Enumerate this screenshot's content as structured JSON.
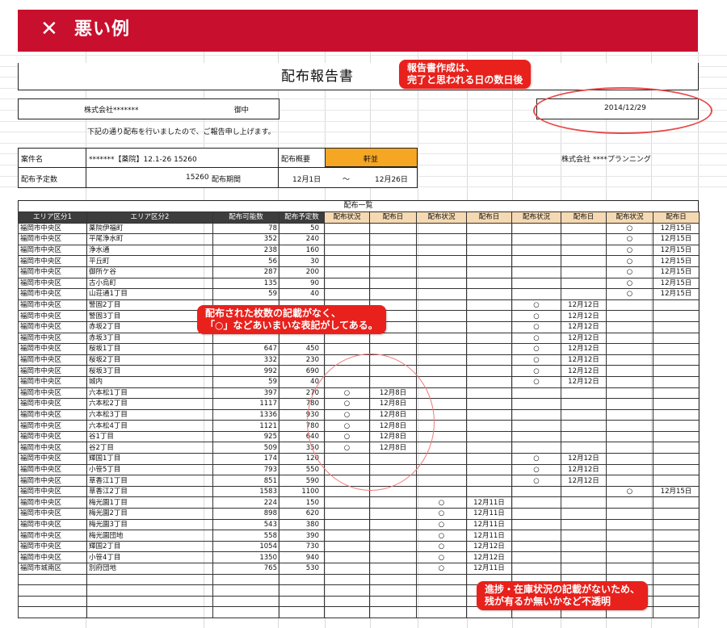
{
  "banner": {
    "mark": "✕",
    "title": "悪い例"
  },
  "report": {
    "title": "配布報告書",
    "recipient_company": "株式会社*******",
    "honorific": "御中",
    "date": "2014/12/29",
    "intro": "下記の通り配布を行いましたので、ご報告申し上げます。",
    "case_label": "案件名",
    "case_value": "*******【薬院】12.1-26 15260",
    "outline_label": "配布概要",
    "outline_value": "軒並",
    "sender": "株式会社 ****プランニング",
    "planned_label": "配布予定数",
    "planned_value": "15260",
    "period_label": "配布期間",
    "period_start": "12月1日",
    "period_sep": "～",
    "period_end": "12月26日"
  },
  "list": {
    "title": "配布一覧",
    "headers": [
      "エリア区分1",
      "エリア区分2",
      "配布可能数",
      "配布予定数",
      "配布状況",
      "配布日",
      "配布状況",
      "配布日",
      "配布状況",
      "配布日",
      "配布状況",
      "配布日"
    ],
    "rows": [
      [
        "福岡市中央区",
        "薬院伊福町",
        "78",
        "50",
        "",
        "",
        "",
        "",
        "",
        "",
        "○",
        "12月15日"
      ],
      [
        "福岡市中央区",
        "平尾浄水町",
        "352",
        "240",
        "",
        "",
        "",
        "",
        "",
        "",
        "○",
        "12月15日"
      ],
      [
        "福岡市中央区",
        "浄水通",
        "238",
        "160",
        "",
        "",
        "",
        "",
        "",
        "",
        "○",
        "12月15日"
      ],
      [
        "福岡市中央区",
        "平丘町",
        "56",
        "30",
        "",
        "",
        "",
        "",
        "",
        "",
        "○",
        "12月15日"
      ],
      [
        "福岡市中央区",
        "御所ケ谷",
        "287",
        "200",
        "",
        "",
        "",
        "",
        "",
        "",
        "○",
        "12月15日"
      ],
      [
        "福岡市中央区",
        "古小烏町",
        "135",
        "90",
        "",
        "",
        "",
        "",
        "",
        "",
        "○",
        "12月15日"
      ],
      [
        "福岡市中央区",
        "山荘通1丁目",
        "59",
        "40",
        "",
        "",
        "",
        "",
        "",
        "",
        "○",
        "12月15日"
      ],
      [
        "福岡市中央区",
        "警固2丁目",
        "",
        "",
        "",
        "",
        "",
        "",
        "○",
        "12月12日",
        "",
        ""
      ],
      [
        "福岡市中央区",
        "警固3丁目",
        "",
        "",
        "",
        "",
        "",
        "",
        "○",
        "12月12日",
        "",
        ""
      ],
      [
        "福岡市中央区",
        "赤坂2丁目",
        "",
        "",
        "",
        "",
        "",
        "",
        "○",
        "12月12日",
        "",
        ""
      ],
      [
        "福岡市中央区",
        "赤坂3丁目",
        "",
        "",
        "",
        "",
        "",
        "",
        "○",
        "12月12日",
        "",
        ""
      ],
      [
        "福岡市中央区",
        "桜坂1丁目",
        "647",
        "450",
        "",
        "",
        "",
        "",
        "○",
        "12月12日",
        "",
        ""
      ],
      [
        "福岡市中央区",
        "桜坂2丁目",
        "332",
        "230",
        "",
        "",
        "",
        "",
        "○",
        "12月12日",
        "",
        ""
      ],
      [
        "福岡市中央区",
        "桜坂3丁目",
        "992",
        "690",
        "",
        "",
        "",
        "",
        "○",
        "12月12日",
        "",
        ""
      ],
      [
        "福岡市中央区",
        "城内",
        "59",
        "40",
        "",
        "",
        "",
        "",
        "○",
        "12月12日",
        "",
        ""
      ],
      [
        "福岡市中央区",
        "六本松1丁目",
        "397",
        "270",
        "○",
        "12月8日",
        "",
        "",
        "",
        "",
        "",
        ""
      ],
      [
        "福岡市中央区",
        "六本松2丁目",
        "1117",
        "780",
        "○",
        "12月8日",
        "",
        "",
        "",
        "",
        "",
        ""
      ],
      [
        "福岡市中央区",
        "六本松3丁目",
        "1336",
        "930",
        "○",
        "12月8日",
        "",
        "",
        "",
        "",
        "",
        ""
      ],
      [
        "福岡市中央区",
        "六本松4丁目",
        "1121",
        "780",
        "○",
        "12月8日",
        "",
        "",
        "",
        "",
        "",
        ""
      ],
      [
        "福岡市中央区",
        "谷1丁目",
        "925",
        "640",
        "○",
        "12月8日",
        "",
        "",
        "",
        "",
        "",
        ""
      ],
      [
        "福岡市中央区",
        "谷2丁目",
        "509",
        "350",
        "○",
        "12月8日",
        "",
        "",
        "",
        "",
        "",
        ""
      ],
      [
        "福岡市中央区",
        "輝国1丁目",
        "174",
        "120",
        "",
        "",
        "",
        "",
        "○",
        "12月12日",
        "",
        ""
      ],
      [
        "福岡市中央区",
        "小笹5丁目",
        "793",
        "550",
        "",
        "",
        "",
        "",
        "○",
        "12月12日",
        "",
        ""
      ],
      [
        "福岡市中央区",
        "草香江1丁目",
        "851",
        "590",
        "",
        "",
        "",
        "",
        "○",
        "12月12日",
        "",
        ""
      ],
      [
        "福岡市中央区",
        "草香江2丁目",
        "1583",
        "1100",
        "",
        "",
        "",
        "",
        "",
        "",
        "○",
        "12月15日"
      ],
      [
        "福岡市中央区",
        "梅光園1丁目",
        "224",
        "150",
        "",
        "",
        "○",
        "12月11日",
        "",
        "",
        "",
        ""
      ],
      [
        "福岡市中央区",
        "梅光園2丁目",
        "898",
        "620",
        "",
        "",
        "○",
        "12月11日",
        "",
        "",
        "",
        ""
      ],
      [
        "福岡市中央区",
        "梅光園3丁目",
        "543",
        "380",
        "",
        "",
        "○",
        "12月11日",
        "",
        "",
        "",
        ""
      ],
      [
        "福岡市中央区",
        "梅光園団地",
        "558",
        "390",
        "",
        "",
        "○",
        "12月11日",
        "",
        "",
        "",
        ""
      ],
      [
        "福岡市中央区",
        "輝国2丁目",
        "1054",
        "730",
        "",
        "",
        "○",
        "12月12日",
        "",
        "",
        "",
        ""
      ],
      [
        "福岡市中央区",
        "小笹4丁目",
        "1350",
        "940",
        "",
        "",
        "○",
        "12月12日",
        "",
        "",
        "",
        ""
      ],
      [
        "福岡市城南区",
        "別府団地",
        "765",
        "530",
        "",
        "",
        "○",
        "12月11日",
        "",
        "",
        "",
        ""
      ]
    ],
    "blank_rows": 4
  },
  "callouts": {
    "date_note": [
      "報告書作成は、",
      "完了と思われる日の数日後"
    ],
    "count_note": [
      "配布された枚数の記載がなく、",
      "「○」などあいまいな表記がしてある。"
    ],
    "stock_note": [
      "進捗・在庫状況の記載がないため、",
      "残が有るか無いかなど不透明"
    ]
  },
  "colors": {
    "banner": "#c8102e",
    "callout": "#e8211c",
    "header_dark": "#3d3d3d",
    "header_tan": "#f5d9b3",
    "outline_fill": "#f5a623"
  }
}
